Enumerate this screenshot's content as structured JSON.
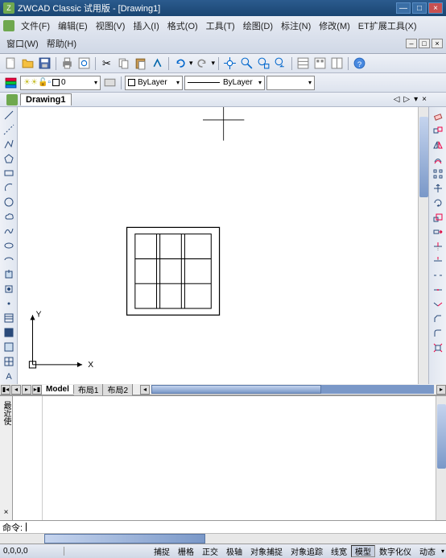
{
  "title": "ZWCAD Classic 试用版 - [Drawing1]",
  "menus": [
    "文件(F)",
    "编辑(E)",
    "视图(V)",
    "插入(I)",
    "格式(O)",
    "工具(T)",
    "绘图(D)",
    "标注(N)",
    "修改(M)",
    "ET扩展工具(X)",
    "窗口(W)",
    "帮助(H)"
  ],
  "doc_tab": "Drawing1",
  "layer_name": "0",
  "color_sel": "ByLayer",
  "linetype_sel": "ByLayer",
  "sheets": {
    "model": "Model",
    "layouts": [
      "布局1",
      "布局2"
    ]
  },
  "cmd_prompt": "命令:",
  "coord": "0,0,0,0",
  "status_buttons": [
    "捕捉",
    "栅格",
    "正交",
    "极轴",
    "对象捕捉",
    "对象追踪",
    "线宽",
    "模型",
    "数字化仪",
    "动态"
  ],
  "axis": {
    "x": "X",
    "y": "Y"
  },
  "vtab": "最近使"
}
